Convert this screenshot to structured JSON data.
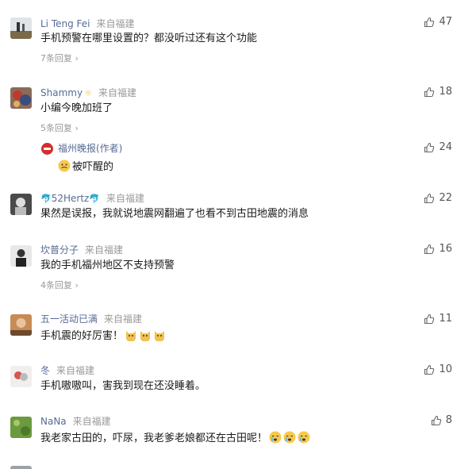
{
  "comments": [
    {
      "name": "Li Teng Fei",
      "location": "来自福建",
      "text": "手机预警在哪里设置的？都没听过还有这个功能",
      "likes": "47",
      "more": "7条回复"
    },
    {
      "name": "Shammy",
      "name_suffix": "☼",
      "location": "来自福建",
      "text": "小编今晚加班了",
      "likes": "18",
      "more": "5条回复"
    },
    {
      "name": "福州晚报(作者)",
      "location": "",
      "text": "被吓醒的",
      "likes": "24",
      "emoji": "grimace-emoji"
    },
    {
      "name_prefix": "🐬",
      "name": "52Hertz",
      "name_suffix": "🐬",
      "location": "来自福建",
      "text": "果然是误报，我就说地震网翻遍了也看不到古田地震的消息",
      "likes": "22"
    },
    {
      "name": "坎普分子",
      "location": "来自福建",
      "text": "我的手机福州地区不支持预警",
      "likes": "16",
      "more": "4条回复"
    },
    {
      "name": "五一活动已满",
      "location": "来自福建",
      "text": "手机震的好厉害！",
      "likes": "11",
      "emoji": "cat-emoji-x3"
    },
    {
      "name": "冬",
      "location": "来自福建",
      "text": "手机嗷嗷叫，害我到现在还没睡着。",
      "likes": "10"
    },
    {
      "name": "NaNa",
      "location": "来自福建",
      "text": "我老家古田的，吓尿，我老爹老娘都还在古田呢！",
      "likes": "8",
      "emoji": "crying-emoji-x3"
    }
  ],
  "colors": {
    "username": "#576b95",
    "meta": "#999999",
    "text": "#1a1a1a",
    "like": "#555555"
  }
}
